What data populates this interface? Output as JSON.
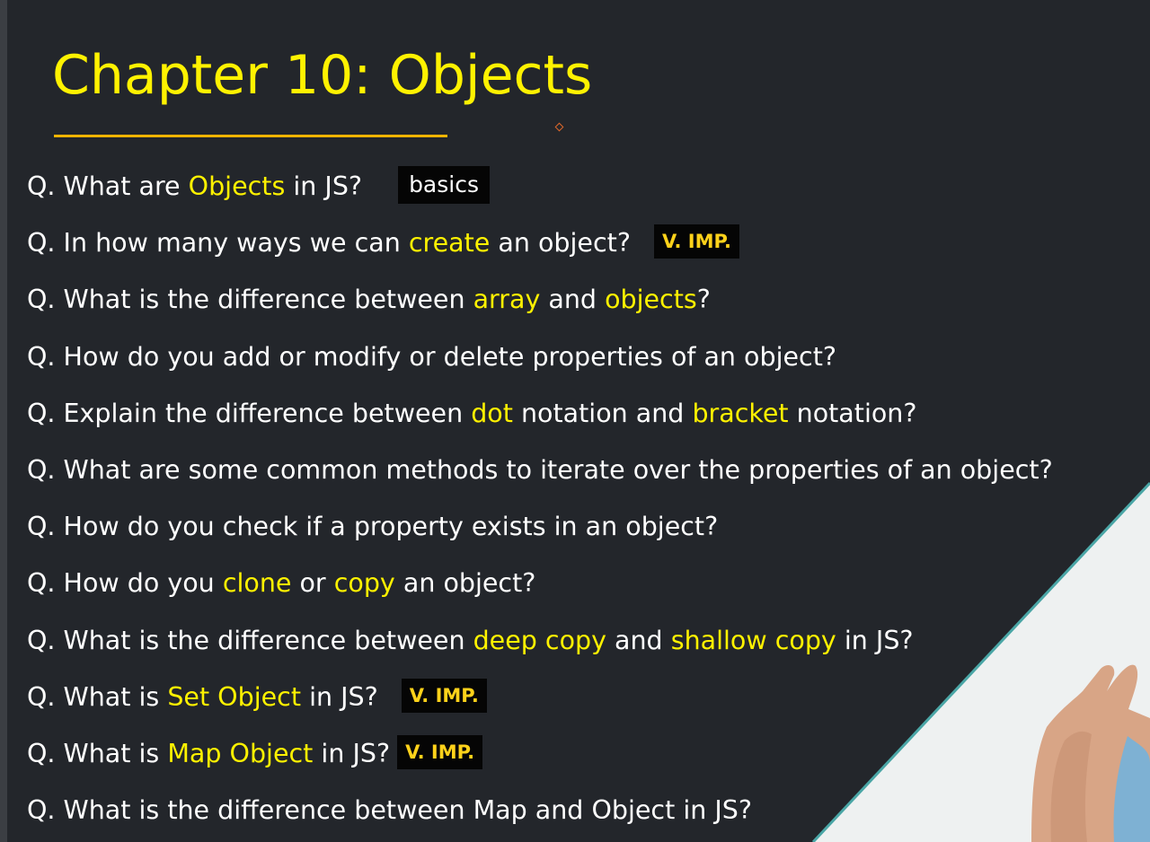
{
  "title": "Chapter 10: Objects",
  "questions": [
    {
      "segments": [
        {
          "text": "Q. What are "
        },
        {
          "text": "Objects",
          "hl": true
        },
        {
          "text": " in JS?"
        }
      ],
      "tag": {
        "text": "basics",
        "style": "basics"
      }
    },
    {
      "segments": [
        {
          "text": "Q. In how many ways we can "
        },
        {
          "text": "create",
          "hl": true
        },
        {
          "text": " an object?"
        }
      ],
      "tag": {
        "text": "V. IMP.",
        "style": "imp"
      }
    },
    {
      "segments": [
        {
          "text": "Q. What is the difference between "
        },
        {
          "text": "array",
          "hl": true
        },
        {
          "text": " and "
        },
        {
          "text": "objects",
          "hl": true
        },
        {
          "text": "?"
        }
      ]
    },
    {
      "segments": [
        {
          "text": "Q. How do you add or modify or delete properties of an object?"
        }
      ]
    },
    {
      "segments": [
        {
          "text": "Q. Explain the difference between "
        },
        {
          "text": "dot",
          "hl": true
        },
        {
          "text": " notation and "
        },
        {
          "text": "bracket",
          "hl": true
        },
        {
          "text": " notation?"
        }
      ]
    },
    {
      "segments": [
        {
          "text": "Q. What are some common methods to iterate over the properties of an object?"
        }
      ]
    },
    {
      "segments": [
        {
          "text": "Q. How do you check if a property exists in an object?"
        }
      ]
    },
    {
      "segments": [
        {
          "text": "Q. How do you "
        },
        {
          "text": "clone",
          "hl": true
        },
        {
          "text": " or "
        },
        {
          "text": "copy",
          "hl": true
        },
        {
          "text": " an object?"
        }
      ]
    },
    {
      "segments": [
        {
          "text": "Q. What is the difference between "
        },
        {
          "text": "deep copy",
          "hl": true
        },
        {
          "text": " and "
        },
        {
          "text": "shallow copy",
          "hl": true
        },
        {
          "text": " in JS?"
        }
      ]
    },
    {
      "segments": [
        {
          "text": "Q. What is "
        },
        {
          "text": "Set Object",
          "hl": true
        },
        {
          "text": " in JS?"
        }
      ],
      "tag": {
        "text": "V. IMP.",
        "style": "imp"
      }
    },
    {
      "segments": [
        {
          "text": "Q. What is "
        },
        {
          "text": "Map Object",
          "hl": true
        },
        {
          "text": " in JS?"
        }
      ],
      "tag": {
        "text": "V. IMP.",
        "style": "imp",
        "tight": true
      }
    },
    {
      "segments": [
        {
          "text": "Q. What is the difference between Map and Object in JS?"
        }
      ]
    }
  ],
  "colors": {
    "background": "#23262b",
    "highlight": "#fff200",
    "rule": "#f5b400",
    "tag_text": "#ffd21a"
  }
}
